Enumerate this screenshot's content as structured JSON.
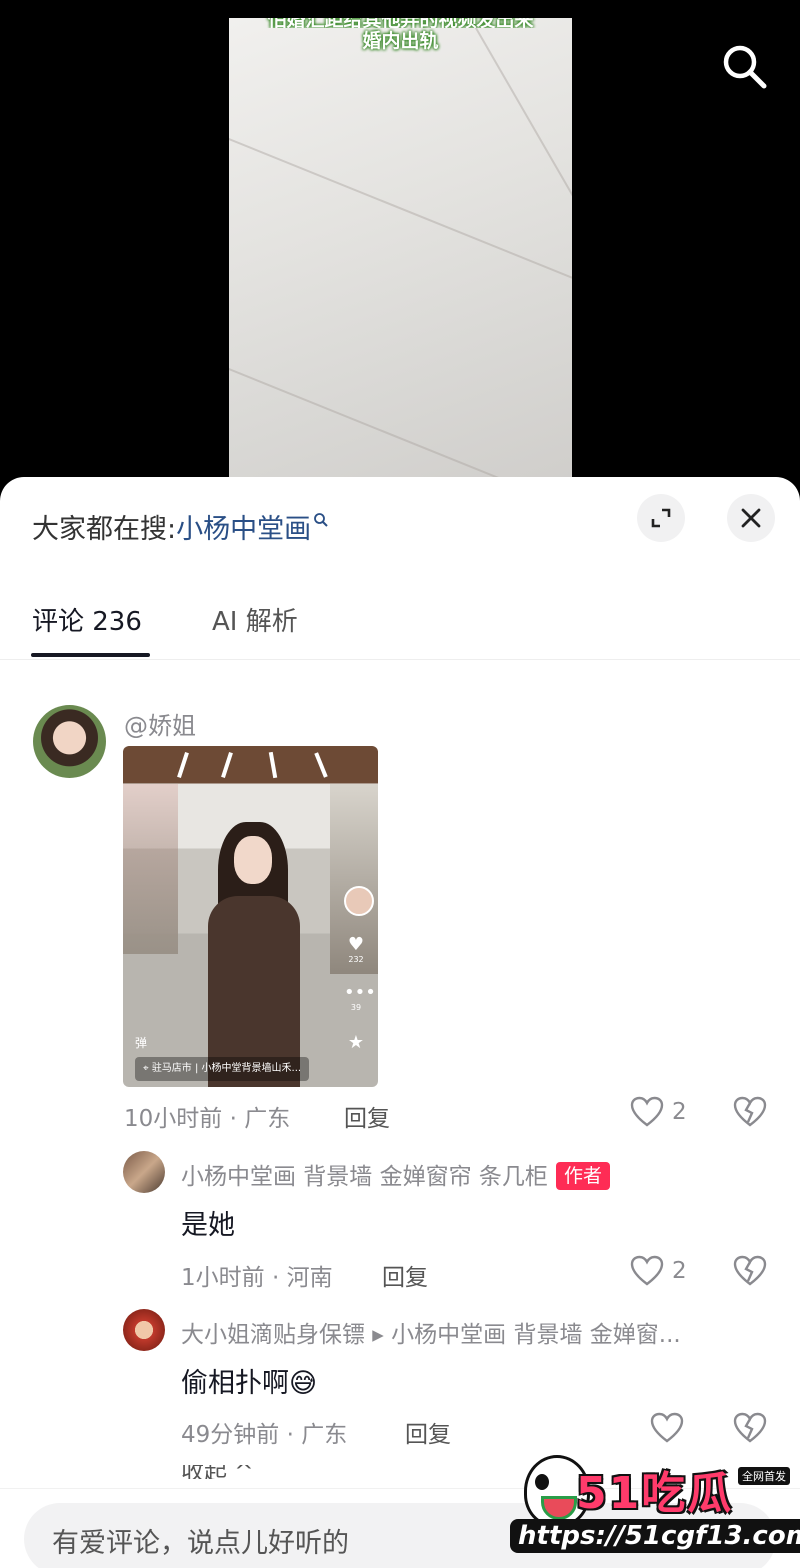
{
  "video": {
    "caption_line1": "怕婚汇距给其他弄的视频发出来",
    "caption_line2": "婚内出轨"
  },
  "sheet": {
    "hot_search_prefix": "大家都在搜:",
    "hot_search_keyword": "小杨中堂画",
    "tabs": [
      {
        "label": "评论 236"
      },
      {
        "label": "AI 解析"
      }
    ]
  },
  "comment": {
    "username": "@娇姐",
    "screenshot": {
      "side_count_like": "232",
      "side_count_comment": "39",
      "location": "驻马店市 | 小杨中堂背景墙山禾...",
      "corner_text": "弹"
    },
    "time_location": "10小时前 · 广东",
    "reply_label": "回复",
    "like_count": "2"
  },
  "replies": [
    {
      "name": "小杨中堂画 背景墙 金婵窗帘 条几柜",
      "badge": "作者",
      "text": "是她",
      "time_location": "1小时前 · 河南",
      "reply_label": "回复",
      "like_count": "2"
    },
    {
      "name": "大小姐滴贴身保镖 ▸ 小杨中堂画 背景墙 金婵窗...",
      "text": "偷相扑啊",
      "emoji": "😅",
      "time_location": "49分钟前 · 广东",
      "reply_label": "回复",
      "like_count": ""
    }
  ],
  "collapse_label": "收起 ^",
  "input": {
    "placeholder": "有爱评论，说点儿好听的"
  },
  "watermark": {
    "logo": "51吃瓜",
    "tag": "全网首发",
    "url": "https://51cgf13.com"
  }
}
